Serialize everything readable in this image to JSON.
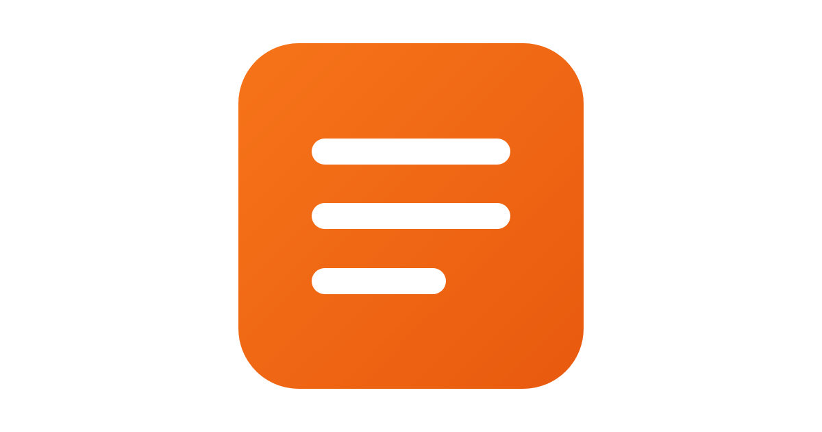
{
  "logo": {
    "icon": "text-lines-icon",
    "shape": "rounded-square",
    "colors": {
      "background_start": "#f77419",
      "background_end": "#e85a0f",
      "lines": "#ffffff",
      "page": "#ffffff"
    },
    "line_count": 3
  }
}
